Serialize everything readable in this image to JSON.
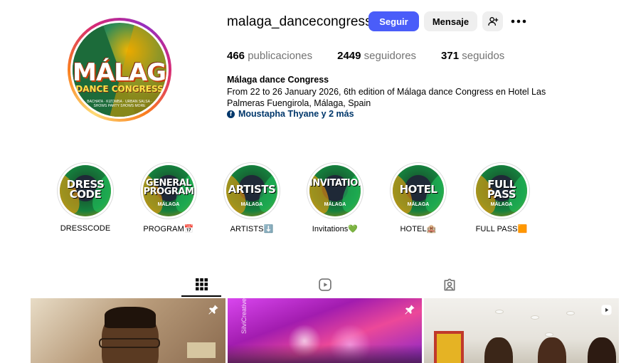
{
  "profile": {
    "username": "malaga_dancecongress",
    "avatar": {
      "main": "MÁLAGA",
      "sub": "DANCE CONGRESS",
      "tiny": "BACHATA · KIZOMBA · URBAN SALSA · SHOWS PARTY SHOWS MORE"
    },
    "follow_label": "Seguir",
    "message_label": "Mensaje",
    "add_user_icon": "person-add-icon",
    "more_icon": "more-options-icon"
  },
  "stats": {
    "posts_count": "466",
    "posts_label": "publicaciones",
    "followers_count": "2449",
    "followers_label": "seguidores",
    "following_count": "371",
    "following_label": "seguidos"
  },
  "bio": {
    "name": "Málaga dance Congress",
    "text": "From 22 to 26 January 2026, 6th edition of Málaga dance Congress en Hotel Las Palmeras Fuengirola, Málaga, Spain",
    "link_text": "Moustapha Thyane y 2 más",
    "link_icon": "facebook-icon"
  },
  "highlights": [
    {
      "title": "DRESS CODE",
      "cover_sub": "",
      "label": "DRESSCODE"
    },
    {
      "title": "GENERAL PROGRAM",
      "cover_sub": "MÁLAGA",
      "label": "PROGRAM📅"
    },
    {
      "title": "ARTISTS",
      "cover_sub": "MÁLAGA",
      "label": "ARTISTS⬇️"
    },
    {
      "title": "INVITATIONS",
      "cover_sub": "MÁLAGA",
      "label": "Invitations💚"
    },
    {
      "title": "HOTEL",
      "cover_sub": "MÁLAGA",
      "label": "HOTEL🏨"
    },
    {
      "title": "FULL PASS",
      "cover_sub": "MÁLAGA",
      "label": "FULL PASS🟧"
    }
  ],
  "tabs": [
    {
      "name": "posts",
      "icon": "grid-icon",
      "active": true
    },
    {
      "name": "reels",
      "icon": "reels-icon",
      "active": false
    },
    {
      "name": "tagged",
      "icon": "tagged-icon",
      "active": false
    }
  ],
  "posts": [
    {
      "icon": "pin-icon"
    },
    {
      "icon": "pin-icon",
      "watermark": "SilviCreative"
    },
    {
      "icon": "reel-icon"
    }
  ],
  "colors": {
    "follow_button": "#4a5df9",
    "secondary_button": "#efefef",
    "link": "#00376b",
    "muted_text": "#737373"
  }
}
